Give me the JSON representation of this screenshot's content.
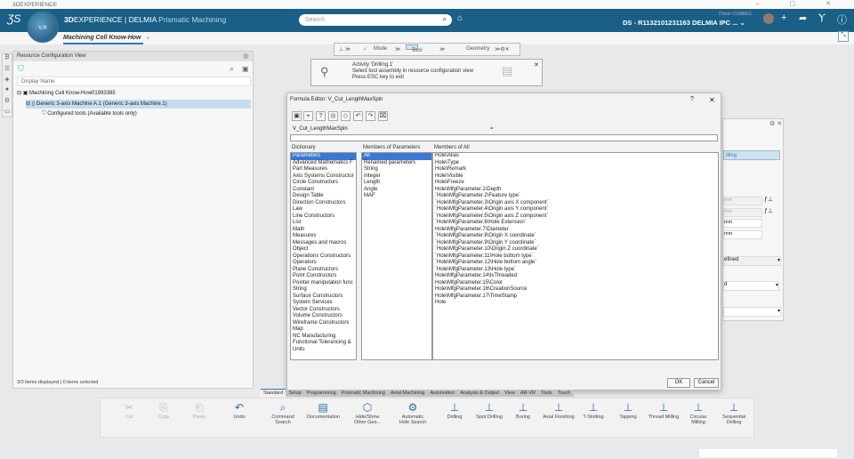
{
  "window": {
    "title": "3DEXPERIENCE",
    "controls": "– ▢ ✕"
  },
  "header": {
    "brand_bold": "3D",
    "brand_rest": "EXPERIENCE | DELMIA",
    "app": "Prismatic Machining",
    "compass_label": "V.R",
    "search_placeholder": "Search",
    "user": "Olivier COMBES",
    "context": "DS - R1132101231163 DELMIA IPC ... ⌄"
  },
  "tabs": {
    "active": "Machining Cell Know-How",
    "add": "+"
  },
  "resource_panel": {
    "title": "Resource Configuration View",
    "column": "Display Name",
    "tree": [
      "Machining Cell Know-How01993385",
      "Generic 3-axis Machine A.1 (Generic 3-axis Machine.1)",
      "Configured tools (Available tools only)"
    ],
    "status": "3/3 items displayed | 0 items selected"
  },
  "workflow": {
    "mode": "Mode",
    "tool": "Tool",
    "geometry": "Geometry"
  },
  "activity": {
    "line1": "Activity 'Drilling.1'",
    "line2": "Select tool assembly in resource configuration view",
    "line3": "Press ESC key to exit"
  },
  "formula_editor": {
    "title": "Formula Editor: V_Cut_LengthMaxSpin",
    "help": "?",
    "close": "✕",
    "parameter_name": "V_Cut_LengthMaxSpin",
    "equals": "=",
    "formula": "",
    "dictionary_label": "Dictionary",
    "members_params_label": "Members of Parameters",
    "members_all_label": "Members of All",
    "dictionary": [
      "Parameters",
      "Advanced Mathematics F",
      "Part Measures",
      "Axis Systems Constructor",
      "Circle Constructors",
      "Constant",
      "Design Table",
      "Direction Constructors",
      "Law",
      "Line Constructors",
      "List",
      "Math",
      "Measures",
      "Messages and macros",
      "Object",
      "Operations Constructors",
      "Operators",
      "Plane Constructors",
      "Point Constructors",
      "Pointer manipulation func",
      "String",
      "Surface Constructors",
      "System Services",
      "Vector Constructors",
      "Volume Constructors",
      "Wireframe Constructors",
      "Map",
      "NC Manufacturing",
      "Functional Tolerancing &",
      "Units"
    ],
    "members_params": [
      "All",
      "Renamed parameters",
      "String",
      "Integer",
      "Length",
      "Angle",
      "MAF"
    ],
    "members_all": [
      "Hole\\Alias",
      "Hole\\Type",
      "Hole\\Remark",
      "Hole\\Visible",
      "Hole\\Freeze",
      "Hole\\MfgParameter.1\\Depth",
      "`Hole\\MfgParameter.2\\Feature type`",
      "`Hole\\MfgParameter.3\\Origin axis X component`",
      "`Hole\\MfgParameter.4\\Origin axis Y component`",
      "`Hole\\MfgParameter.5\\Origin axis Z component`",
      "`Hole\\MfgParameter.6\\Hole Extension`",
      "Hole\\MfgParameter.7\\Diameter",
      "`Hole\\MfgParameter.8\\Origin X coordinate`",
      "`Hole\\MfgParameter.9\\Origin Y coordinate`",
      "`Hole\\MfgParameter.10\\Origin Z coordinate`",
      "`Hole\\MfgParameter.11\\Hole bottom type`",
      "`Hole\\MfgParameter.12\\Hole bottom angle`",
      "`Hole\\MfgParameter.13\\Hole type`",
      "Hole\\MfgParameter.14\\IsThreaded",
      "Hole\\MfgParameter.15\\Color",
      "Hole\\MfgParameter.16\\CreationSource",
      "Hole\\MfgParameter.17\\TimeStamp",
      "Hole"
    ],
    "ok": "OK",
    "cancel": "Cancel"
  },
  "right_panel": {
    "selected": "illing",
    "units": [
      "mm",
      "mm",
      "mm",
      "mm"
    ],
    "dropdown1": "efined",
    "dropdown2": "d",
    "dropdown3": ""
  },
  "ribbon": {
    "tabs": [
      "Standard",
      "Setup",
      "Programming",
      "Prismatic Machining",
      "Axial Machining",
      "Automation",
      "Analysis & Output",
      "View",
      "AR-VR",
      "Tools",
      "Touch"
    ],
    "commands": [
      "Cut",
      "Copy",
      "Paste",
      "Undo",
      "Command Search",
      "Documentation",
      "Hide/Show Other Geo...",
      "Automatic Hole Search",
      "Drilling",
      "Spot Drilling",
      "Boring",
      "Axial Finishing",
      "T-Slotting",
      "Tapping",
      "Thread Milling",
      "Circular Milling",
      "Sequential Drilling"
    ]
  },
  "colors": {
    "header": "#1a5f85",
    "selection": "#3a78d6",
    "tree_selection": "#c7dcf0"
  }
}
